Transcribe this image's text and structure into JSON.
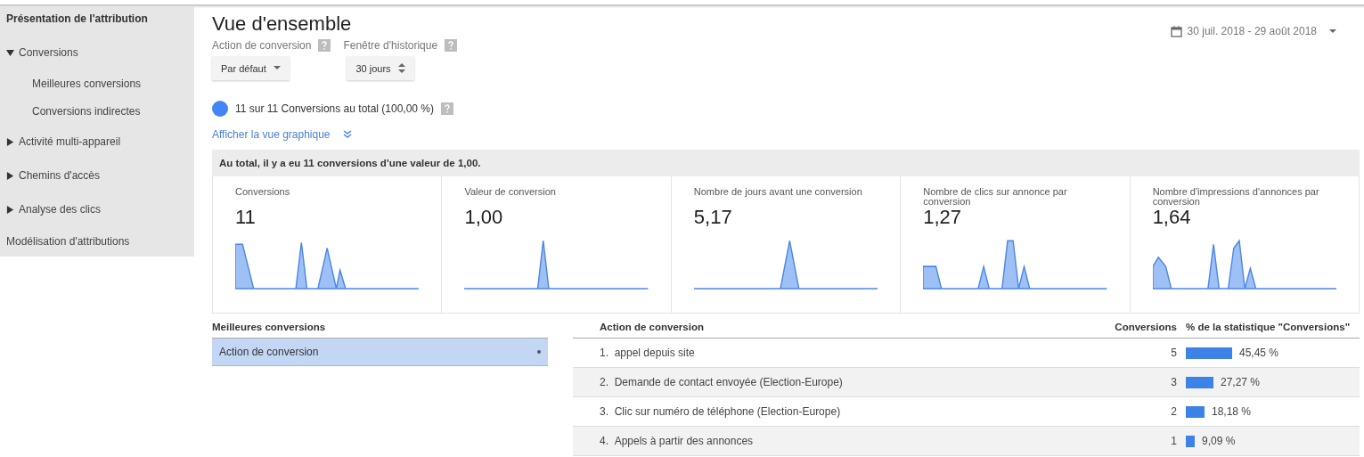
{
  "sidebar": {
    "title": "Présentation de l'attribution",
    "items": [
      {
        "label": "Conversions",
        "expanded": true,
        "children": [
          {
            "label": "Meilleures conversions"
          },
          {
            "label": "Conversions indirectes"
          }
        ]
      },
      {
        "label": "Activité multi-appareil",
        "expanded": false
      },
      {
        "label": "Chemins d'accès",
        "expanded": false
      },
      {
        "label": "Analyse des clics",
        "expanded": false
      }
    ],
    "footer": "Modélisation d'attributions"
  },
  "header": {
    "title": "Vue d'ensemble",
    "date_range": "30 juil. 2018 - 29 août 2018",
    "filters": [
      {
        "label": "Action de conversion",
        "value": "Par défaut",
        "kind": "dropdown"
      },
      {
        "label": "Fenêtre d'historique",
        "value": "30 jours",
        "kind": "stepper"
      }
    ]
  },
  "segment": {
    "label": "11 sur 11 Conversions au total (100,00 %)",
    "color": "#4285f4"
  },
  "chart_link": "Afficher la vue graphique",
  "summary": "Au total, il y a eu 11 conversions d'une valeur de 1,00.",
  "metrics": [
    {
      "label": "Conversions",
      "value": "11"
    },
    {
      "label": "Valeur de conversion",
      "value": "1,00"
    },
    {
      "label": "Nombre de jours avant une conversion",
      "value": "5,17"
    },
    {
      "label": "Nombre de clics sur annonce par conversion",
      "value": "1,27"
    },
    {
      "label": "Nombre d'impressions d'annonces par conversion",
      "value": "1,64"
    }
  ],
  "dimension_panel": {
    "title": "Meilleures conversions",
    "items": [
      {
        "label": "Action de conversion",
        "selected": true
      }
    ]
  },
  "table": {
    "columns": [
      "Action de conversion",
      "Conversions",
      "% de la statistique \"Conversions\""
    ],
    "rows": [
      {
        "rank": "1.",
        "name": "appel depuis site",
        "conversions": "5",
        "percent": "45,45 %"
      },
      {
        "rank": "2.",
        "name": "Demande de contact envoyée (Election-Europe)",
        "conversions": "3",
        "percent": "27,27 %"
      },
      {
        "rank": "3.",
        "name": "Clic sur numéro de téléphone (Election-Europe)",
        "conversions": "2",
        "percent": "18,18 %"
      },
      {
        "rank": "4.",
        "name": "Appels à partir des annonces",
        "conversions": "1",
        "percent": "9,09 %"
      }
    ]
  }
}
